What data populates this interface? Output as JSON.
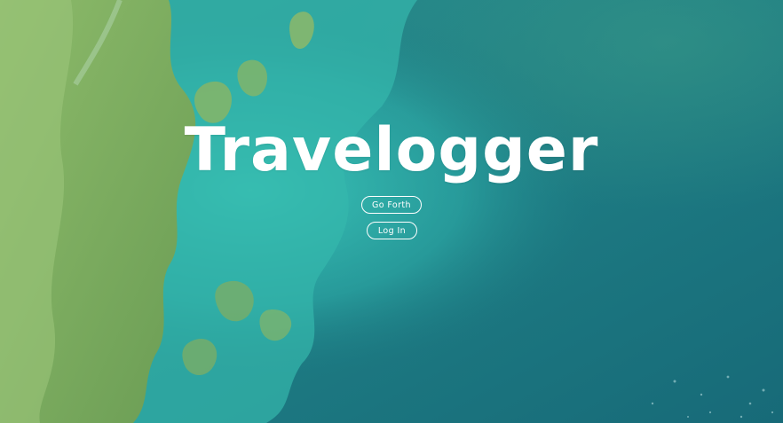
{
  "app": {
    "title": "Travelogger"
  },
  "actions": {
    "go_forth_label": "Go Forth",
    "log_in_label": "Log In"
  },
  "colors": {
    "ocean": "#1f7f86",
    "shallows": "#37c2b5",
    "land": "#7aa95c",
    "text": "#ffffff"
  }
}
